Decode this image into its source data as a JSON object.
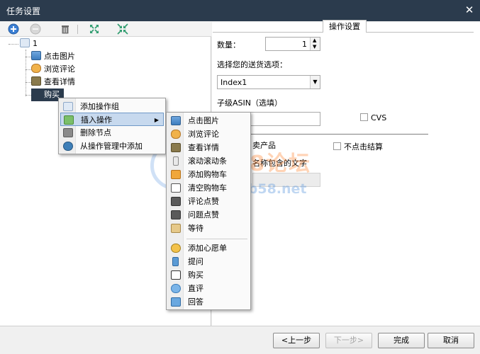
{
  "window": {
    "title": "任务设置",
    "close_glyph": "✕"
  },
  "toolbar": {
    "icons": [
      "add-circle-icon",
      "remove-circle-icon",
      "trash-icon",
      "expand-icon",
      "collapse-icon"
    ]
  },
  "tree": {
    "root_label": "1",
    "items": [
      {
        "label": "点击图片",
        "icon": "image-icon"
      },
      {
        "label": "浏览评论",
        "icon": "hand-icon"
      },
      {
        "label": "查看详情",
        "icon": "document-icon"
      },
      {
        "label": "购买",
        "icon": "cart-icon",
        "selected": true
      }
    ]
  },
  "context_menu": {
    "items": [
      {
        "label": "添加操作组",
        "icon": "cursor-icon"
      },
      {
        "label": "插入操作",
        "icon": "insert-icon",
        "submenu_arrow": "▶"
      },
      {
        "label": "删除节点",
        "icon": "trash-icon"
      },
      {
        "label": "从操作管理中添加",
        "icon": "manage-icon"
      }
    ]
  },
  "submenu": {
    "group1": [
      {
        "label": "点击图片",
        "icon": "image-icon"
      },
      {
        "label": "浏览评论",
        "icon": "hand-icon"
      },
      {
        "label": "查看详情",
        "icon": "document-icon"
      },
      {
        "label": "滚动滚动条",
        "icon": "scroll-icon"
      },
      {
        "label": "添加购物车",
        "icon": "cart-add-icon"
      },
      {
        "label": "清空购物车",
        "icon": "cart-empty-icon"
      },
      {
        "label": "评论点赞",
        "icon": "thumb-up-icon"
      },
      {
        "label": "问题点赞",
        "icon": "thumb-up-icon"
      },
      {
        "label": "等待",
        "icon": "hourglass-icon"
      }
    ],
    "group2": [
      {
        "label": "添加心愿单",
        "icon": "wishlist-icon"
      },
      {
        "label": "提问",
        "icon": "question-icon"
      },
      {
        "label": "购买",
        "icon": "cart-icon"
      },
      {
        "label": "直评",
        "icon": "comment-icon"
      },
      {
        "label": "回答",
        "icon": "answer-icon"
      }
    ]
  },
  "settings": {
    "tab_title": "操作设置",
    "quantity_label": "数量：",
    "quantity_value": "1",
    "shipping_label": "选择您的送货选项：",
    "shipping_value": "Index1",
    "child_asin_label": "子级ASIN（选填）",
    "child_asin_value": "",
    "cvs_label": "CVS",
    "cvs_checked": false,
    "fragment_sell_product": "卖产品",
    "no_click_checkout_label": "不点击结算",
    "no_click_checkout_checked": false,
    "fragment_name_contains": "名称包含的文字"
  },
  "footer": {
    "prev_label": "<上一步",
    "next_label": "下一步>",
    "finish_label": "完成",
    "cancel_label": "取消"
  },
  "watermark": {
    "text": "TB58论坛",
    "url": "www.tb58.net"
  },
  "colors": {
    "titlebar": "#2b3b4d",
    "menu_highlight": "#c7d9ee",
    "selection": "#2b3b4d"
  }
}
